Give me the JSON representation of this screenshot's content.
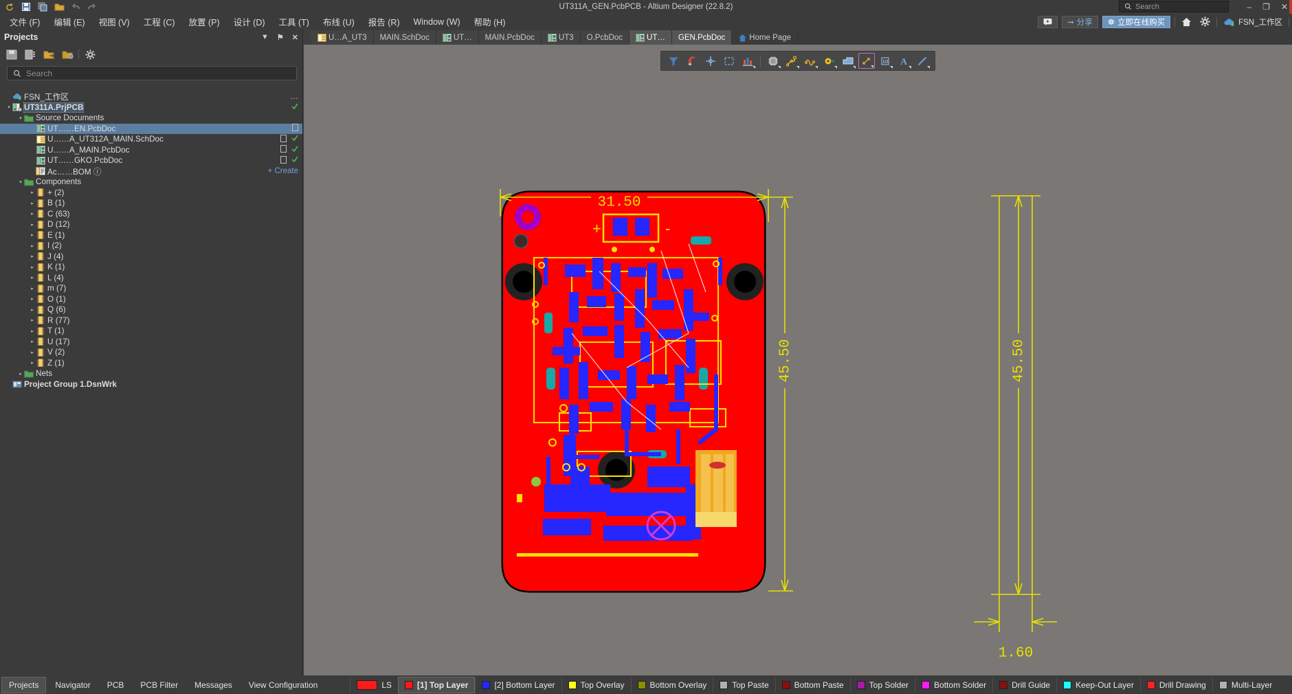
{
  "window": {
    "title": "UT311A_GEN.PcbPCB - Altium Designer (22.8.2)",
    "search_placeholder": "Search",
    "minimize": "–",
    "maximize": "❐",
    "close": "✕"
  },
  "menubar": {
    "items": [
      {
        "label": "文件 (F)",
        "name": "menu-file"
      },
      {
        "label": "编辑 (E)",
        "name": "menu-edit"
      },
      {
        "label": "视图 (V)",
        "name": "menu-view"
      },
      {
        "label": "工程 (C)",
        "name": "menu-project"
      },
      {
        "label": "放置 (P)",
        "name": "menu-place"
      },
      {
        "label": "设计 (D)",
        "name": "menu-design"
      },
      {
        "label": "工具 (T)",
        "name": "menu-tools"
      },
      {
        "label": "布线 (U)",
        "name": "menu-route"
      },
      {
        "label": "报告 (R)",
        "name": "menu-reports"
      },
      {
        "label": "Window (W)",
        "name": "menu-window"
      },
      {
        "label": "帮助 (H)",
        "name": "menu-help"
      }
    ],
    "right": {
      "notes": "➕",
      "share": "分享",
      "buy": "立即在线购买",
      "workspace": "FSN_工作区"
    }
  },
  "tabs": [
    {
      "label": "U…A_UT3",
      "icon": "sch-icon",
      "active": false
    },
    {
      "label": "MAIN.SchDoc",
      "icon": "sch-icon",
      "active": false
    },
    {
      "label": "UT…",
      "icon": "pcb-icon",
      "active": false
    },
    {
      "label": "MAIN.PcbDoc",
      "icon": "pcb-icon",
      "active": false
    },
    {
      "label": "UT3",
      "icon": "pcb-icon",
      "active": false
    },
    {
      "label": "O.PcbDoc",
      "icon": "pcb-icon",
      "active": false
    },
    {
      "label": "UT…",
      "icon": "pcb-icon",
      "active": true
    },
    {
      "label": "GEN.PcbDoc",
      "icon": "pcb-icon",
      "active": true
    },
    {
      "label": "Home Page",
      "icon": "home-icon",
      "active": false
    }
  ],
  "panel": {
    "title": "Projects",
    "header_buttons": {
      "dropdown": "▼",
      "pin": "⚑",
      "close": "✕"
    },
    "search_placeholder": "Search",
    "create_label": "+ Create"
  },
  "tree": [
    {
      "depth": 0,
      "arrow": "",
      "icon": "cloud-icon",
      "label": "FSN_工作区",
      "bold": false,
      "more": "…"
    },
    {
      "depth": 0,
      "arrow": "▾",
      "icon": "project-icon",
      "label": "UT311A.PrjPCB",
      "bold": true,
      "check": true,
      "highlight": true
    },
    {
      "depth": 1,
      "arrow": "▾",
      "icon": "folder-icon",
      "label": "Source Documents",
      "bold": false
    },
    {
      "depth": 2,
      "arrow": "",
      "icon": "pcb-icon",
      "label": "UT……EN.PcbDoc",
      "selected": true,
      "doc": true
    },
    {
      "depth": 2,
      "arrow": "",
      "icon": "sch-icon",
      "label": "U……A_UT312A_MAIN.SchDoc",
      "doc": true,
      "check": true
    },
    {
      "depth": 2,
      "arrow": "",
      "icon": "pcb-icon",
      "label": "U……A_MAIN.PcbDoc",
      "doc": true,
      "check": true
    },
    {
      "depth": 2,
      "arrow": "",
      "icon": "pcb-icon",
      "label": "UT……GKO.PcbDoc",
      "doc": true,
      "check": true
    },
    {
      "depth": 2,
      "arrow": "",
      "icon": "bom-icon",
      "label": "Ac……BOM ⓘ",
      "create": true
    },
    {
      "depth": 1,
      "arrow": "▾",
      "icon": "folder-icon",
      "label": "Components"
    },
    {
      "depth": 2,
      "arrow": "▸",
      "icon": "comp-icon",
      "label": "+ (2)"
    },
    {
      "depth": 2,
      "arrow": "▸",
      "icon": "comp-icon",
      "label": "B (1)"
    },
    {
      "depth": 2,
      "arrow": "▸",
      "icon": "comp-icon",
      "label": "C (63)"
    },
    {
      "depth": 2,
      "arrow": "▸",
      "icon": "comp-icon",
      "label": "D (12)"
    },
    {
      "depth": 2,
      "arrow": "▸",
      "icon": "comp-icon",
      "label": "E (1)"
    },
    {
      "depth": 2,
      "arrow": "▸",
      "icon": "comp-icon",
      "label": "I (2)"
    },
    {
      "depth": 2,
      "arrow": "▸",
      "icon": "comp-icon",
      "label": "J (4)"
    },
    {
      "depth": 2,
      "arrow": "▸",
      "icon": "comp-icon",
      "label": "K (1)"
    },
    {
      "depth": 2,
      "arrow": "▸",
      "icon": "comp-icon",
      "label": "L (4)"
    },
    {
      "depth": 2,
      "arrow": "▸",
      "icon": "comp-icon",
      "label": "m (7)"
    },
    {
      "depth": 2,
      "arrow": "▸",
      "icon": "comp-icon",
      "label": "O (1)"
    },
    {
      "depth": 2,
      "arrow": "▸",
      "icon": "comp-icon",
      "label": "Q (6)"
    },
    {
      "depth": 2,
      "arrow": "▸",
      "icon": "comp-icon",
      "label": "R (77)"
    },
    {
      "depth": 2,
      "arrow": "▸",
      "icon": "comp-icon",
      "label": "T (1)"
    },
    {
      "depth": 2,
      "arrow": "▸",
      "icon": "comp-icon",
      "label": "U (17)"
    },
    {
      "depth": 2,
      "arrow": "▸",
      "icon": "comp-icon",
      "label": "V (2)"
    },
    {
      "depth": 2,
      "arrow": "▸",
      "icon": "comp-icon",
      "label": "Z (1)"
    },
    {
      "depth": 1,
      "arrow": "▸",
      "icon": "folder-icon",
      "label": "Nets"
    },
    {
      "depth": 0,
      "arrow": "",
      "icon": "workspace-icon",
      "label": "Project Group 1.DsnWrk",
      "bold": true
    }
  ],
  "pcb_toolbar": [
    {
      "name": "filter-icon",
      "glyph": "funnel"
    },
    {
      "name": "snap-magnet-icon",
      "glyph": "magnet"
    },
    {
      "name": "crosshair-icon",
      "glyph": "cross"
    },
    {
      "name": "selection-box-icon",
      "glyph": "dashbox"
    },
    {
      "name": "layer-stack-icon",
      "glyph": "bars"
    },
    {
      "name": "component-icon",
      "glyph": "chip"
    },
    {
      "name": "route-track-icon",
      "glyph": "track"
    },
    {
      "name": "net-icon",
      "glyph": "squiggle"
    },
    {
      "name": "pad-icon",
      "glyph": "pad"
    },
    {
      "name": "polygon-pour-icon",
      "glyph": "poly"
    },
    {
      "name": "dimension-icon",
      "glyph": "dim"
    },
    {
      "name": "coordinate-icon",
      "glyph": "coord"
    },
    {
      "name": "text-icon",
      "glyph": "A"
    },
    {
      "name": "line-icon",
      "glyph": "line"
    }
  ],
  "pcb": {
    "width_dim": "31.50",
    "height_dim": "45.50",
    "side_height_dim": "45.50",
    "thickness_dim": "1.60",
    "plus_marker": "+",
    "minus_marker": "-"
  },
  "bottom_tabs": [
    {
      "label": "Projects",
      "active": true
    },
    {
      "label": "Navigator",
      "active": false
    },
    {
      "label": "PCB",
      "active": false
    },
    {
      "label": "PCB Filter",
      "active": false
    },
    {
      "label": "Messages",
      "active": false
    },
    {
      "label": "View Configuration",
      "active": false
    }
  ],
  "layers": [
    {
      "label": "LS",
      "color": "#ff1a1a",
      "wide": true,
      "active": false
    },
    {
      "label": "[1] Top Layer",
      "color": "#ff1a1a",
      "active": true
    },
    {
      "label": "[2] Bottom Layer",
      "color": "#2626ff",
      "active": false
    },
    {
      "label": "Top Overlay",
      "color": "#ffff1a",
      "active": false
    },
    {
      "label": "Bottom Overlay",
      "color": "#8d8d00",
      "active": false
    },
    {
      "label": "Top Paste",
      "color": "#b0b0b0",
      "active": false
    },
    {
      "label": "Bottom Paste",
      "color": "#8a0f0f",
      "active": false
    },
    {
      "label": "Top Solder",
      "color": "#a61aa6",
      "active": false
    },
    {
      "label": "Bottom Solder",
      "color": "#ff1aff",
      "active": false
    },
    {
      "label": "Drill Guide",
      "color": "#8a0f0f",
      "active": false
    },
    {
      "label": "Keep-Out Layer",
      "color": "#1affff",
      "active": false
    },
    {
      "label": "Drill Drawing",
      "color": "#ff2424",
      "active": false
    },
    {
      "label": "Multi-Layer",
      "color": "#b0b0b0",
      "active": false
    }
  ]
}
